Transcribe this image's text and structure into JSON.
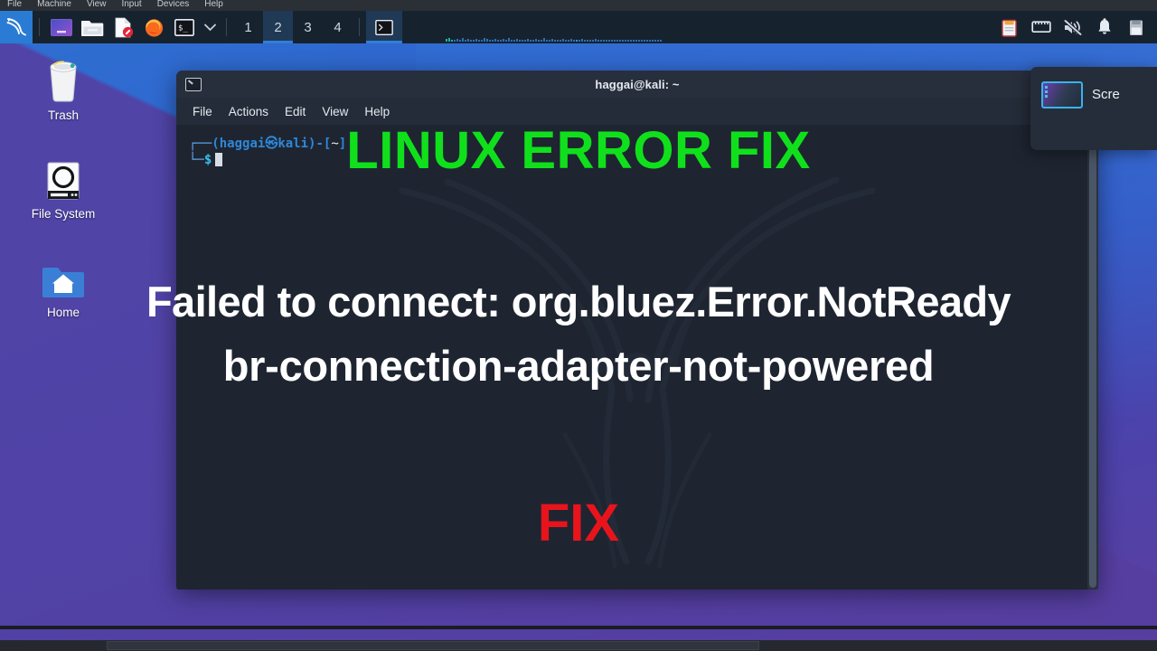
{
  "vbox": {
    "menu": [
      "File",
      "Machine",
      "View",
      "Input",
      "Devices",
      "Help"
    ]
  },
  "panel": {
    "launchers": [
      {
        "name": "kali-menu-icon",
        "label": "Kali Menu"
      },
      {
        "name": "app-window-icon",
        "label": "Application Finder"
      },
      {
        "name": "file-manager-icon",
        "label": "File Manager"
      },
      {
        "name": "text-editor-icon",
        "label": "Text Editor"
      },
      {
        "name": "firefox-icon",
        "label": "Firefox"
      },
      {
        "name": "terminal-icon",
        "label": "Terminal"
      }
    ],
    "chevron": "chevron-down-icon",
    "workspaces": [
      "1",
      "2",
      "3",
      "4"
    ],
    "active_workspace": "2",
    "window_button": "terminal-window-button",
    "tray": [
      {
        "name": "clipboard-icon"
      },
      {
        "name": "network-icon"
      },
      {
        "name": "volume-muted-icon"
      },
      {
        "name": "notification-bell-icon"
      },
      {
        "name": "clipboard-manager-icon"
      }
    ]
  },
  "desktop": {
    "icons": [
      {
        "label": "Trash",
        "icon": "trash-icon"
      },
      {
        "label": "File System",
        "icon": "harddisk-icon"
      },
      {
        "label": "Home",
        "icon": "home-folder-icon"
      }
    ]
  },
  "terminal": {
    "title": "haggai@kali: ~",
    "window_icon": "terminal-icon",
    "menu": [
      "File",
      "Actions",
      "Edit",
      "View",
      "Help"
    ],
    "prompt": {
      "corner_top": "┌──",
      "open_paren": "(",
      "user": "haggai",
      "at": "㉿",
      "host": "kali",
      "close_paren": ")-[",
      "path": "~",
      "close_bracket": "]",
      "corner_bottom": "└─",
      "dollar": "$"
    }
  },
  "overlays": {
    "headline": "LINUX ERROR FIX",
    "headline_color": "#10e01c",
    "error_line1": "Failed to connect: org.bluez.Error.NotReady",
    "error_line2": "br-connection-adapter-not-powered",
    "error_color": "#ffffff",
    "fix": "FIX",
    "fix_color": "#e8141c"
  },
  "popup": {
    "label": "Scre",
    "thumb_icon": "screenshot-thumbnail-icon"
  }
}
